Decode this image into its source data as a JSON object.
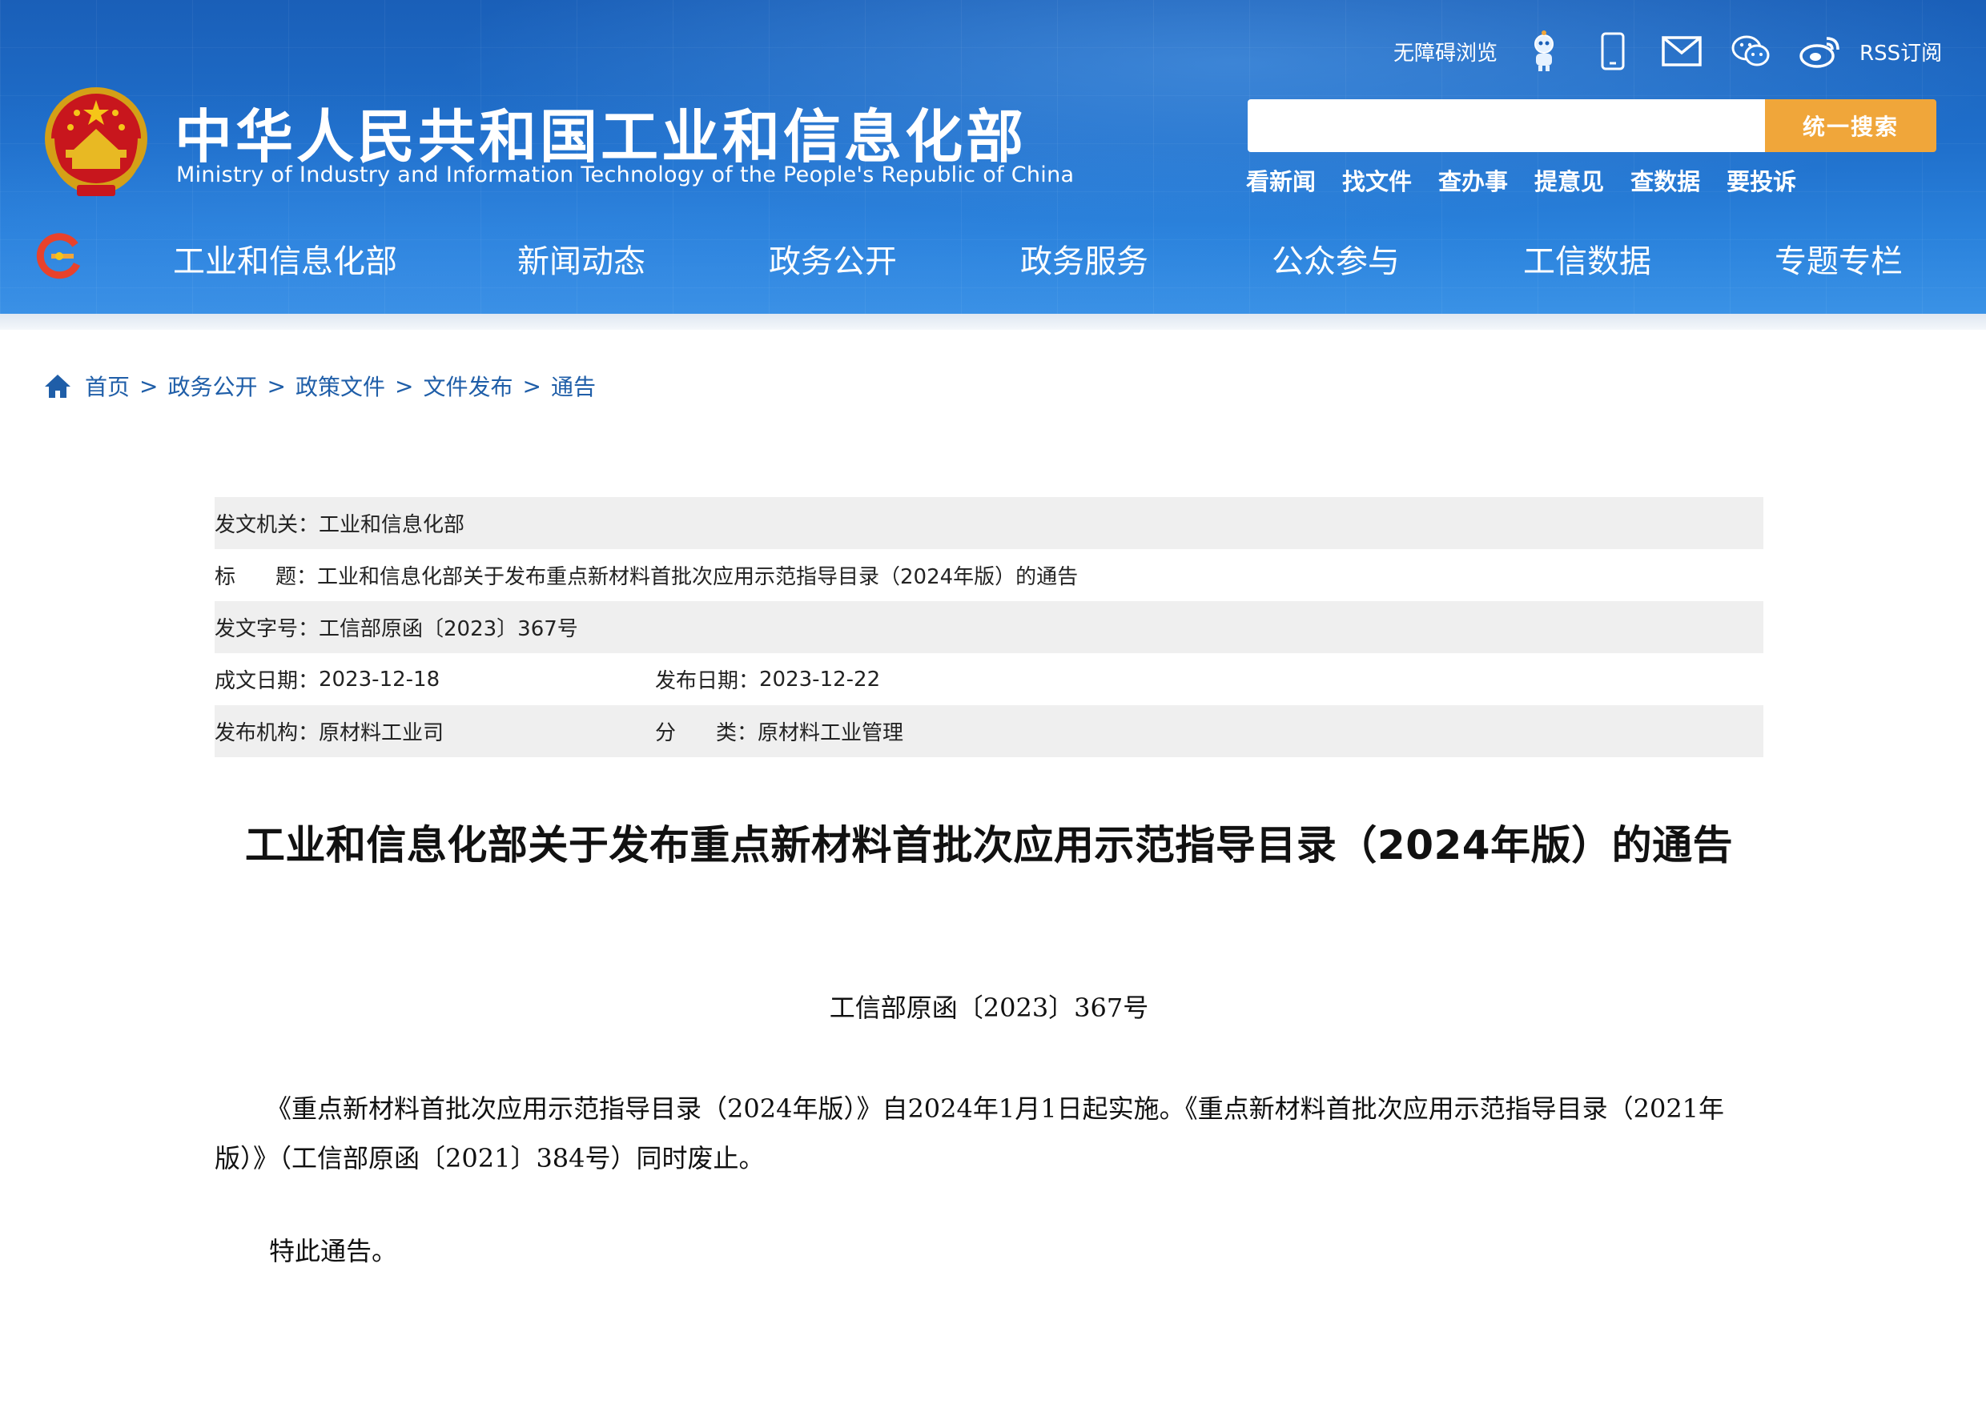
{
  "header": {
    "title": "中华人民共和国工业和信息化部",
    "subtitle": "Ministry of Industry and Information Technology of the People's Republic of China",
    "accessibility_label": "无障碍浏览",
    "rss_label": "RSS订阅",
    "icons": [
      "robot-icon",
      "mobile-icon",
      "mail-icon",
      "wechat-icon",
      "weibo-icon"
    ],
    "search": {
      "placeholder": "",
      "button_label": "统一搜索"
    },
    "quick_links": [
      "看新闻",
      "找文件",
      "查办事",
      "提意见",
      "查数据",
      "要投诉"
    ],
    "nav": [
      "工业和信息化部",
      "新闻动态",
      "政务公开",
      "政务服务",
      "公众参与",
      "工信数据",
      "专题专栏"
    ]
  },
  "breadcrumb": [
    "首页",
    "政务公开",
    "政策文件",
    "文件发布",
    "通告"
  ],
  "breadcrumb_separator": ">",
  "meta": {
    "issuer_label": "发文机关：",
    "issuer": "工业和信息化部",
    "title_label_1": "标",
    "title_label_2": "题：",
    "title": "工业和信息化部关于发布重点新材料首批次应用示范指导目录（2024年版）的通告",
    "doc_no_label": "发文字号：",
    "doc_no": "工信部原函〔2023〕367号",
    "written_label": "成文日期：",
    "written": "2023-12-18",
    "published_label": "发布日期：",
    "published": "2023-12-22",
    "org_label": "发布机构：",
    "org": "原材料工业司",
    "category_label_1": "分",
    "category_label_2": "类：",
    "category": "原材料工业管理"
  },
  "article": {
    "title": "工业和信息化部关于发布重点新材料首批次应用示范指导目录（2024年版）的通告",
    "doc_number": "工信部原函〔2023〕367号",
    "paragraph": "《重点新材料首批次应用示范指导目录（2024年版）》自2024年1月1日起实施。《重点新材料首批次应用示范指导目录（2021年版）》（工信部原函〔2021〕384号）同时废止。",
    "closing": "特此通告。"
  },
  "colors": {
    "header_blue": "#1f6fcb",
    "search_button": "#f0a63a",
    "breadcrumb_link": "#1f5ea8",
    "meta_row_shade": "#efefef"
  }
}
